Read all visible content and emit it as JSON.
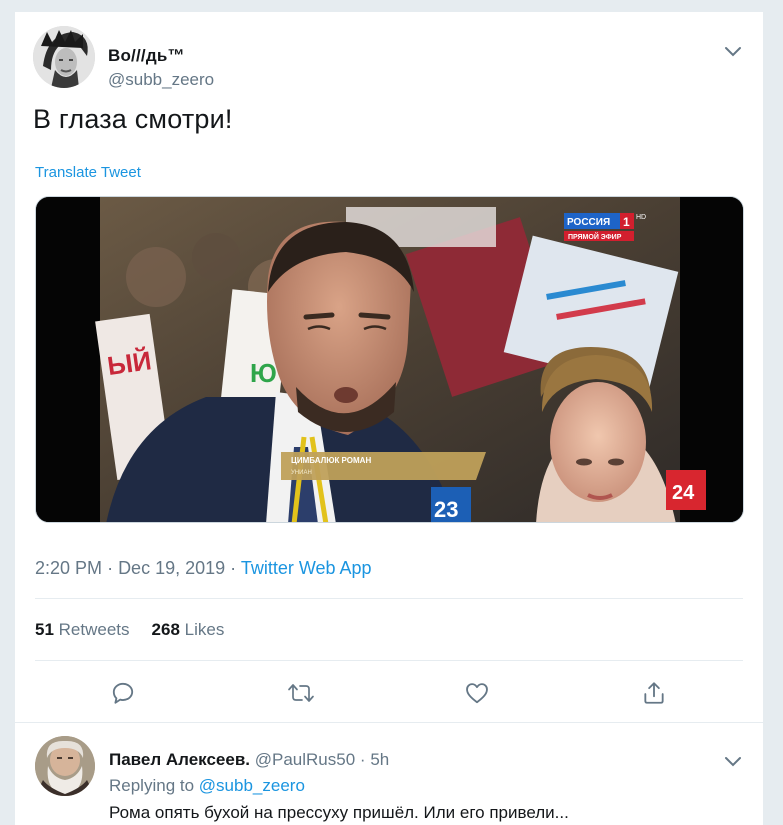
{
  "tweet": {
    "author_name": "Во///дь™",
    "author_handle": "@subb_zeero",
    "text": "В глаза смотри!",
    "translate_label": "Translate Tweet",
    "time": "2:20 PM",
    "date": "Dec 19, 2019",
    "source": "Twitter Web App",
    "retweets_count": "51",
    "retweets_label": "Retweets",
    "likes_count": "268",
    "likes_label": "Likes"
  },
  "media": {
    "logo_top": "РОССИЯ",
    "logo_number": "1",
    "logo_hd": "HD",
    "logo_live": "ПРЯМОЙ ЭФИР",
    "caption_name": "ЦИМБАЛЮК РОМАН",
    "caption_sub": "УНИАН",
    "channel_number": "24",
    "mic_number": "23"
  },
  "reply": {
    "author_name": "Павел Алексеев.",
    "author_handle": "@PaulRus50",
    "time": "5h",
    "replying_to_label": "Replying to",
    "replying_to_handle": "@subb_zeero",
    "text": "Рома опять бухой на прессуху пришёл. Или его привели..."
  },
  "colors": {
    "accent": "#1b95e0",
    "muted": "#657786",
    "text": "#14171a",
    "border": "#e6ecf0"
  },
  "icons": [
    "chevron-down-icon",
    "reply-icon",
    "retweet-icon",
    "like-icon",
    "share-icon"
  ]
}
